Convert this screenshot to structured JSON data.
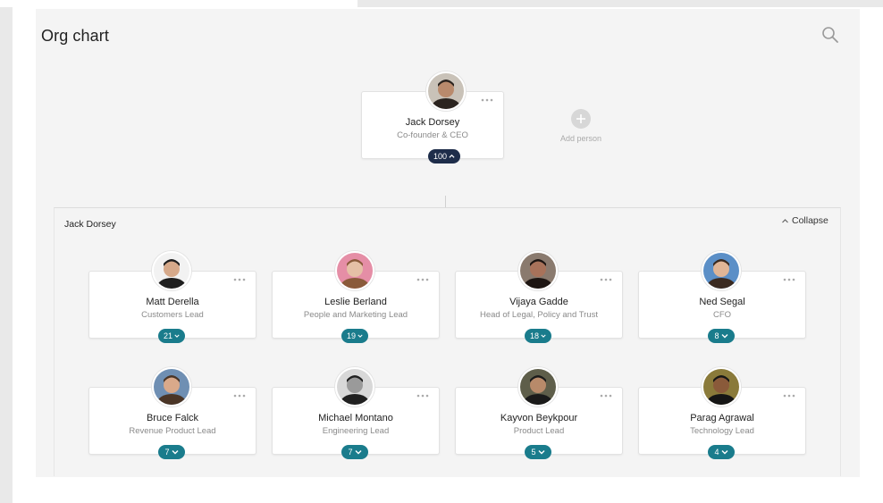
{
  "page": {
    "title": "Org chart"
  },
  "root": {
    "name": "Jack Dorsey",
    "role": "Co-founder & CEO",
    "count": "100",
    "avatar_colors": {
      "bg": "#c9c2b8",
      "skin": "#b98a6c",
      "hair": "#2b241f"
    }
  },
  "add_person": {
    "label": "Add person"
  },
  "group": {
    "title": "Jack Dorsey",
    "collapse_label": "Collapse"
  },
  "reports": [
    {
      "name": "Matt Derella",
      "role": "Customers Lead",
      "count": "21",
      "avatar_colors": {
        "bg": "#f2f2f2",
        "skin": "#d6a98a",
        "hair": "#1e1e1e"
      }
    },
    {
      "name": "Leslie Berland",
      "role": "People and Marketing Lead",
      "count": "19",
      "avatar_colors": {
        "bg": "#e58ea6",
        "skin": "#e5c0a6",
        "hair": "#8a5a3a"
      }
    },
    {
      "name": "Vijaya Gadde",
      "role": "Head of Legal, Policy and Trust",
      "count": "18",
      "avatar_colors": {
        "bg": "#8a7a6e",
        "skin": "#a8725a",
        "hair": "#1d1512"
      }
    },
    {
      "name": "Ned Segal",
      "role": "CFO",
      "count": "8",
      "avatar_colors": {
        "bg": "#5b8fc7",
        "skin": "#e0b596",
        "hair": "#3a2a20"
      }
    },
    {
      "name": "Bruce Falck",
      "role": "Revenue Product Lead",
      "count": "7",
      "avatar_colors": {
        "bg": "#6f8fb3",
        "skin": "#d9a98a",
        "hair": "#4a3526"
      }
    },
    {
      "name": "Michael Montano",
      "role": "Engineering Lead",
      "count": "7",
      "avatar_colors": {
        "bg": "#d8d8d8",
        "skin": "#9a9a9a",
        "hair": "#202020"
      }
    },
    {
      "name": "Kayvon Beykpour",
      "role": "Product Lead",
      "count": "5",
      "avatar_colors": {
        "bg": "#5e5e4a",
        "skin": "#b88a6a",
        "hair": "#1a1a1a"
      }
    },
    {
      "name": "Parag Agrawal",
      "role": "Technology Lead",
      "count": "4",
      "avatar_colors": {
        "bg": "#8a7a3a",
        "skin": "#8a5a3a",
        "hair": "#151515"
      }
    }
  ],
  "colors": {
    "badge_dark": "#1e2d4a",
    "badge_teal": "#1a7c8c"
  }
}
